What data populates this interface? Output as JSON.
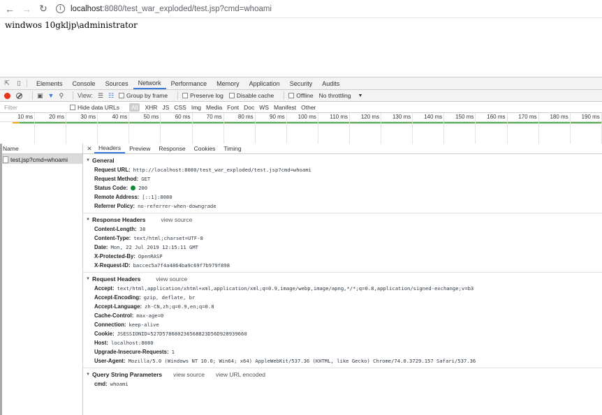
{
  "browser": {
    "url_host": "localhost",
    "url_rest": ":8080/test_war_exploded/test.jsp?cmd=whoami"
  },
  "page": {
    "output_text": "windwos 10gkljp\\administrator"
  },
  "devtools": {
    "tabs": [
      "Elements",
      "Console",
      "Sources",
      "Network",
      "Performance",
      "Memory",
      "Application",
      "Security",
      "Audits"
    ],
    "active_tab": "Network",
    "toolbar": {
      "view_label": "View:",
      "group_by_frame": "Group by frame",
      "preserve_log": "Preserve log",
      "disable_cache": "Disable cache",
      "offline": "Offline",
      "throttling": "No throttling"
    },
    "filter": {
      "placeholder": "Filter",
      "hide_data_urls": "Hide data URLs",
      "types": [
        "All",
        "XHR",
        "JS",
        "CSS",
        "Img",
        "Media",
        "Font",
        "Doc",
        "WS",
        "Manifest",
        "Other"
      ]
    },
    "timeline_ticks": [
      "10 ms",
      "20 ms",
      "30 ms",
      "40 ms",
      "50 ms",
      "60 ms",
      "70 ms",
      "80 ms",
      "90 ms",
      "100 ms",
      "110 ms",
      "120 ms",
      "130 ms",
      "140 ms",
      "150 ms",
      "160 ms",
      "170 ms",
      "180 ms",
      "190 ms"
    ],
    "name_header": "Name",
    "request_name": "test.jsp?cmd=whoami",
    "detail_tabs": [
      "Headers",
      "Preview",
      "Response",
      "Cookies",
      "Timing"
    ],
    "general": {
      "title": "General",
      "rows": [
        {
          "k": "Request URL:",
          "v": "http://localhost:8080/test_war_exploded/test.jsp?cmd=whoami"
        },
        {
          "k": "Request Method:",
          "v": "GET"
        },
        {
          "k": "Status Code:",
          "v": "200"
        },
        {
          "k": "Remote Address:",
          "v": "[::1]:8080"
        },
        {
          "k": "Referrer Policy:",
          "v": "no-referrer-when-downgrade"
        }
      ]
    },
    "response_headers": {
      "title": "Response Headers",
      "view_source": "view source",
      "rows": [
        {
          "k": "Content-Length:",
          "v": "38"
        },
        {
          "k": "Content-Type:",
          "v": "text/html;charset=UTF-8"
        },
        {
          "k": "Date:",
          "v": "Mon, 22 Jul 2019 12:15:11 GMT"
        },
        {
          "k": "X-Protected-By:",
          "v": "OpenRASP"
        },
        {
          "k": "X-Request-ID:",
          "v": "baccec5a7f4a4864ba9c69f7b979f898"
        }
      ]
    },
    "request_headers": {
      "title": "Request Headers",
      "view_source": "view source",
      "rows": [
        {
          "k": "Accept:",
          "v": "text/html,application/xhtml+xml,application/xml;q=0.9,image/webp,image/apng,*/*;q=0.8,application/signed-exchange;v=b3"
        },
        {
          "k": "Accept-Encoding:",
          "v": "gzip, deflate, br"
        },
        {
          "k": "Accept-Language:",
          "v": "zh-CN,zh;q=0.9,en;q=0.8"
        },
        {
          "k": "Cache-Control:",
          "v": "max-age=0"
        },
        {
          "k": "Connection:",
          "v": "keep-alive"
        },
        {
          "k": "Cookie:",
          "v": "JSESSIONID=527D578680236568823D56D928939660"
        },
        {
          "k": "Host:",
          "v": "localhost:8080"
        },
        {
          "k": "Upgrade-Insecure-Requests:",
          "v": "1"
        },
        {
          "k": "User-Agent:",
          "v": "Mozilla/5.0 (Windows NT 10.0; Win64; x64) AppleWebKit/537.36 (KHTML, like Gecko) Chrome/74.0.3729.157 Safari/537.36"
        }
      ]
    },
    "query_params": {
      "title": "Query String Parameters",
      "view_source": "view source",
      "view_url_encoded": "view URL encoded",
      "rows": [
        {
          "k": "cmd:",
          "v": "whoami"
        }
      ]
    },
    "colors": {
      "accent": "#3879d9",
      "record": "#e8321b",
      "status_ok": "#0a8c34",
      "timeline_green": "#4caf50"
    }
  }
}
